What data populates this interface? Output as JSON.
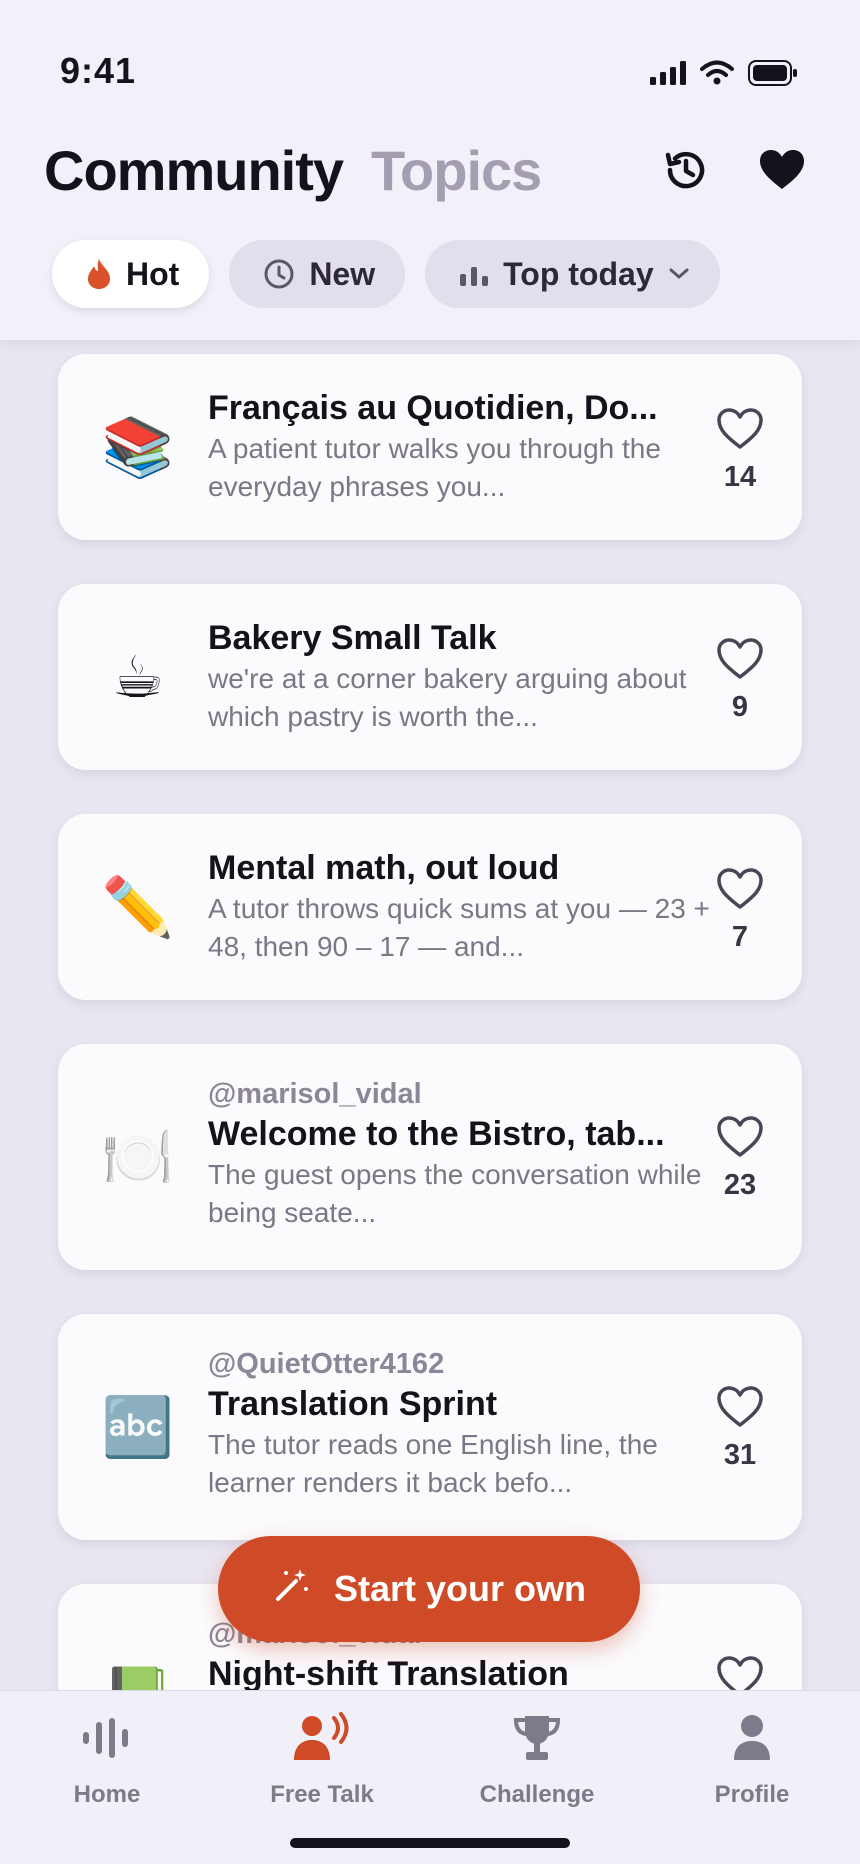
{
  "status": {
    "time": "9:41"
  },
  "header": {
    "tabs": [
      {
        "label": "Community",
        "active": true
      },
      {
        "label": "Topics",
        "active": false
      }
    ],
    "icons": [
      "history-icon",
      "heart-filled-icon"
    ]
  },
  "filters": [
    {
      "label": "Hot",
      "icon": "flame-icon",
      "selected": true
    },
    {
      "label": "New",
      "icon": "clock-icon",
      "selected": false
    },
    {
      "label": "Top today",
      "icon": "bar-chart-icon",
      "selected": false,
      "dropdown": true
    }
  ],
  "cards": [
    {
      "emoji": "📚",
      "author": "",
      "title": "Français au Quotidien, Do...",
      "description": "A patient tutor walks you through the everyday phrases you...",
      "likes": "14"
    },
    {
      "emoji": "☕",
      "author": "",
      "title": "Bakery Small Talk",
      "description": "we're at a corner bakery arguing about which pastry is worth the...",
      "likes": "9"
    },
    {
      "emoji": "✏️",
      "author": "",
      "title": "Mental math, out loud",
      "description": "A tutor throws quick sums at you — 23 + 48, then 90 – 17 — and...",
      "likes": "7"
    },
    {
      "emoji": "🍽️",
      "author": "@marisol_vidal",
      "title": "Welcome to the Bistro, tab...",
      "description": "The guest opens the conversation while being seate...",
      "likes": "23"
    },
    {
      "emoji": "🔤",
      "author": "@QuietOtter4162",
      "title": "Translation Sprint",
      "description": "The tutor reads one English line, the learner renders it back befo...",
      "likes": "31"
    },
    {
      "emoji": "📗",
      "author": "@marisol_vidal",
      "title": "Night-shift Translation",
      "description": "",
      "likes": ""
    }
  ],
  "fab": {
    "label": "Start your own",
    "icon": "magic-wand-icon"
  },
  "tabbar": [
    {
      "label": "Home",
      "icon": "waveform-icon",
      "active": false
    },
    {
      "label": "Free Talk",
      "icon": "person-speaking-icon",
      "active": true
    },
    {
      "label": "Challenge",
      "icon": "trophy-icon",
      "active": false
    },
    {
      "label": "Profile",
      "icon": "person-icon",
      "active": false
    }
  ],
  "colors": {
    "accent": "#cf4a26",
    "background": "#e9e6f1",
    "card": "#fbfafd",
    "text": "#14121b",
    "muted": "#7c7787"
  }
}
